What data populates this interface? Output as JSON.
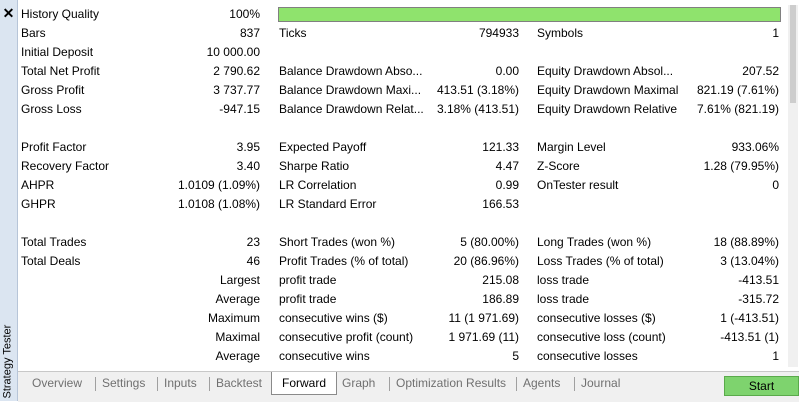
{
  "panel": {
    "title": "Strategy Tester",
    "close_glyph": "✕"
  },
  "quality": {
    "label": "History Quality",
    "value": "100%",
    "fill_fraction": 1.0,
    "bar_color": "#8fe36d"
  },
  "summary_rows": [
    {
      "l1": "Bars",
      "v1": "837",
      "l2": "Ticks",
      "v2": "794933",
      "l3": "Symbols",
      "v3": "1"
    },
    {
      "l1": "Initial Deposit",
      "v1": "10 000.00",
      "l2": "",
      "v2": "",
      "l3": "",
      "v3": ""
    },
    {
      "l1": "Total Net Profit",
      "v1": "2 790.62",
      "l2": "Balance Drawdown Abso...",
      "v2": "0.00",
      "l3": "Equity Drawdown Absol...",
      "v3": "207.52"
    },
    {
      "l1": "Gross Profit",
      "v1": "3 737.77",
      "l2": "Balance Drawdown Maxi...",
      "v2": "413.51 (3.18%)",
      "l3": "Equity Drawdown Maximal",
      "v3": "821.19 (7.61%)"
    },
    {
      "l1": "Gross Loss",
      "v1": "-947.15",
      "l2": "Balance Drawdown Relat...",
      "v2": "3.18% (413.51)",
      "l3": "Equity Drawdown Relative",
      "v3": "7.61% (821.19)"
    }
  ],
  "ratio_rows": [
    {
      "l1": "Profit Factor",
      "v1": "3.95",
      "l2": "Expected Payoff",
      "v2": "121.33",
      "l3": "Margin Level",
      "v3": "933.06%"
    },
    {
      "l1": "Recovery Factor",
      "v1": "3.40",
      "l2": "Sharpe Ratio",
      "v2": "4.47",
      "l3": "Z-Score",
      "v3": "1.28 (79.95%)"
    },
    {
      "l1": "AHPR",
      "v1": "1.0109 (1.09%)",
      "l2": "LR Correlation",
      "v2": "0.99",
      "l3": "OnTester result",
      "v3": "0"
    },
    {
      "l1": "GHPR",
      "v1": "1.0108 (1.08%)",
      "l2": "LR Standard Error",
      "v2": "166.53",
      "l3": "",
      "v3": ""
    }
  ],
  "trade_rows": [
    {
      "l1": "Total Trades",
      "v1": "23",
      "l2": "Short Trades (won %)",
      "v2": "5 (80.00%)",
      "l3": "Long Trades (won %)",
      "v3": "18 (88.89%)"
    },
    {
      "l1": "Total Deals",
      "v1": "46",
      "l2": "Profit Trades (% of total)",
      "v2": "20 (86.96%)",
      "l3": "Loss Trades (% of total)",
      "v3": "3 (13.04%)"
    }
  ],
  "detail_rows": [
    {
      "q": "Largest",
      "l2": "profit trade",
      "v2": "215.08",
      "l3": "loss trade",
      "v3": "-413.51"
    },
    {
      "q": "Average",
      "l2": "profit trade",
      "v2": "186.89",
      "l3": "loss trade",
      "v3": "-315.72"
    },
    {
      "q": "Maximum",
      "l2": "consecutive wins ($)",
      "v2": "11 (1 971.69)",
      "l3": "consecutive losses ($)",
      "v3": "1 (-413.51)"
    },
    {
      "q": "Maximal",
      "l2": "consecutive profit (count)",
      "v2": "1 971.69 (11)",
      "l3": "consecutive loss (count)",
      "v3": "-413.51 (1)"
    },
    {
      "q": "Average",
      "l2": "consecutive wins",
      "v2": "5",
      "l3": "consecutive losses",
      "v3": "1"
    }
  ],
  "tabs": [
    "Overview",
    "Settings",
    "Inputs",
    "Backtest",
    "Forward",
    "Graph",
    "Optimization Results",
    "Agents",
    "Journal"
  ],
  "active_tab": "Forward",
  "start_label": "Start",
  "colors": {
    "panel_bg": "#dbe5f1",
    "start_bg": "#7ed36e"
  }
}
